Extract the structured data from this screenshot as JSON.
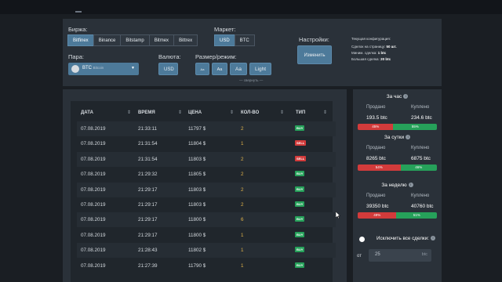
{
  "exchange": {
    "label": "Биржа:",
    "options": [
      "Bitfinex",
      "Binance",
      "Bitstamp",
      "Bitmex",
      "Bittrex"
    ],
    "selected": "Bitfinex"
  },
  "market": {
    "label": "Маркет:",
    "options": [
      "USD",
      "BTC"
    ],
    "selected": "USD"
  },
  "settings": {
    "label": "Настройки:",
    "change_button": "Изменить"
  },
  "current_config": {
    "title": "Текущая конфигурация:",
    "per_page_label": "Сделок на страницу:",
    "per_page_value": "50 шт.",
    "min_label": "Миним. сделка:",
    "min_value": "1 btc",
    "max_label": "Большая сделка:",
    "max_value": "20 btc"
  },
  "pair": {
    "label": "Пара:",
    "symbol": "BTC",
    "name": "Bitcoin"
  },
  "currency": {
    "label": "Валюта:",
    "value": "USD"
  },
  "size_mode": {
    "label": "Размер/режим:",
    "options": [
      "Aa",
      "Aa",
      "Aa",
      "Light"
    ]
  },
  "collapse_label": "свернуть",
  "table": {
    "headers": [
      "ДАТА",
      "ВРЕМЯ",
      "ЦЕНА",
      "КОЛ-ВО",
      "ТИП"
    ],
    "rows": [
      {
        "date": "07.08.2019",
        "time": "21:33:11",
        "price": "11797 $",
        "qty": "2",
        "type": "BUY"
      },
      {
        "date": "07.08.2019",
        "time": "21:31:54",
        "price": "11804 $",
        "qty": "1",
        "type": "SELL"
      },
      {
        "date": "07.08.2019",
        "time": "21:31:54",
        "price": "11803 $",
        "qty": "2",
        "type": "SELL"
      },
      {
        "date": "07.08.2019",
        "time": "21:29:32",
        "price": "11805 $",
        "qty": "2",
        "type": "BUY"
      },
      {
        "date": "07.08.2019",
        "time": "21:29:17",
        "price": "11803 $",
        "qty": "2",
        "type": "BUY"
      },
      {
        "date": "07.08.2019",
        "time": "21:29:17",
        "price": "11803 $",
        "qty": "2",
        "type": "BUY"
      },
      {
        "date": "07.08.2019",
        "time": "21:29:17",
        "price": "11800 $",
        "qty": "6",
        "type": "BUY"
      },
      {
        "date": "07.08.2019",
        "time": "21:29:17",
        "price": "11800 $",
        "qty": "1",
        "type": "BUY"
      },
      {
        "date": "07.08.2019",
        "time": "21:28:43",
        "price": "11802 $",
        "qty": "1",
        "type": "BUY"
      },
      {
        "date": "07.08.2019",
        "time": "21:27:39",
        "price": "11790 $",
        "qty": "1",
        "type": "BUY"
      }
    ]
  },
  "stats": {
    "sold_label": "Продано",
    "bought_label": "Куплено",
    "blocks": [
      {
        "title": "За час",
        "sold": "193.5 btc",
        "bought": "234.6 btc",
        "sell_pct": "45%",
        "buy_pct": "55%",
        "sell_frac": 0.45
      },
      {
        "title": "За сутки",
        "sold": "8265 btc",
        "bought": "6875 btc",
        "sell_pct": "54%",
        "buy_pct": "46%",
        "sell_frac": 0.54
      },
      {
        "title": "За неделю",
        "sold": "39350 btc",
        "bought": "40760 btc",
        "sell_pct": "49%",
        "buy_pct": "51%",
        "sell_frac": 0.49
      }
    ]
  },
  "exclude": {
    "label": "Исключить все сделки:",
    "from_label": "от",
    "from_value": "25",
    "unit": "btc"
  },
  "colors": {
    "accent": "#4d7a9a",
    "buy": "#26a15a",
    "sell": "#d23b3b",
    "qty": "#e1b34a"
  }
}
